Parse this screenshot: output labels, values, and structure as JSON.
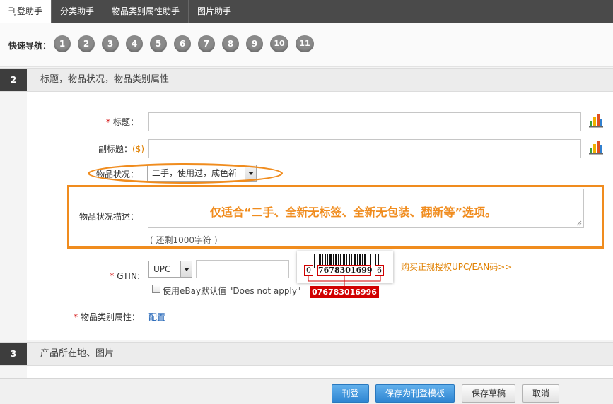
{
  "tabs": [
    {
      "label": "刊登助手",
      "active": true
    },
    {
      "label": "分类助手",
      "active": false
    },
    {
      "label": "物品类别属性助手",
      "active": false
    },
    {
      "label": "图片助手",
      "active": false
    }
  ],
  "quicknav": {
    "label": "快速导航：",
    "steps": [
      "1",
      "2",
      "3",
      "4",
      "5",
      "6",
      "7",
      "8",
      "9",
      "10",
      "11"
    ]
  },
  "section2": {
    "number": "2",
    "title": "标题，物品状况，物品类别属性"
  },
  "section3": {
    "number": "3",
    "title": "产品所在地、图片"
  },
  "form": {
    "title_label": "标题：",
    "subtitle_label": "副标题：",
    "subtitle_fee": "($)",
    "condition_label": "物品状况：",
    "condition_value": "二手，使用过，成色新",
    "condition_desc_label": "物品状况描述：",
    "annotation": "仅适合“二手、全新无标签、全新无包装、翻新等”选项。",
    "char_hint": "( 还剩1000字符 )",
    "gtin_label": "GTIN:",
    "gtin_type": "UPC",
    "gtin_value": "",
    "gtin_checkbox_label": "使用eBay默认值 \"Does not apply\"",
    "buy_upc_link": "购买正规授权UPC/EAN码>>",
    "category_attr_label": "物品类别属性：",
    "config_link": "配置",
    "required_mark": "*"
  },
  "barcode": {
    "left_digit": "0",
    "middle_digits": "7678301699",
    "right_digit": "6",
    "full_code": "076783016996"
  },
  "footer": {
    "publish": "刊登",
    "save_template": "保存为刊登模板",
    "save_draft": "保存草稿",
    "cancel": "取消"
  },
  "colors": {
    "accent_orange": "#f08c1e",
    "required_red": "#d10000",
    "link_blue": "#1a5fb4",
    "button_blue": "#2f86d2",
    "tab_bar": "#4a4a4a"
  }
}
